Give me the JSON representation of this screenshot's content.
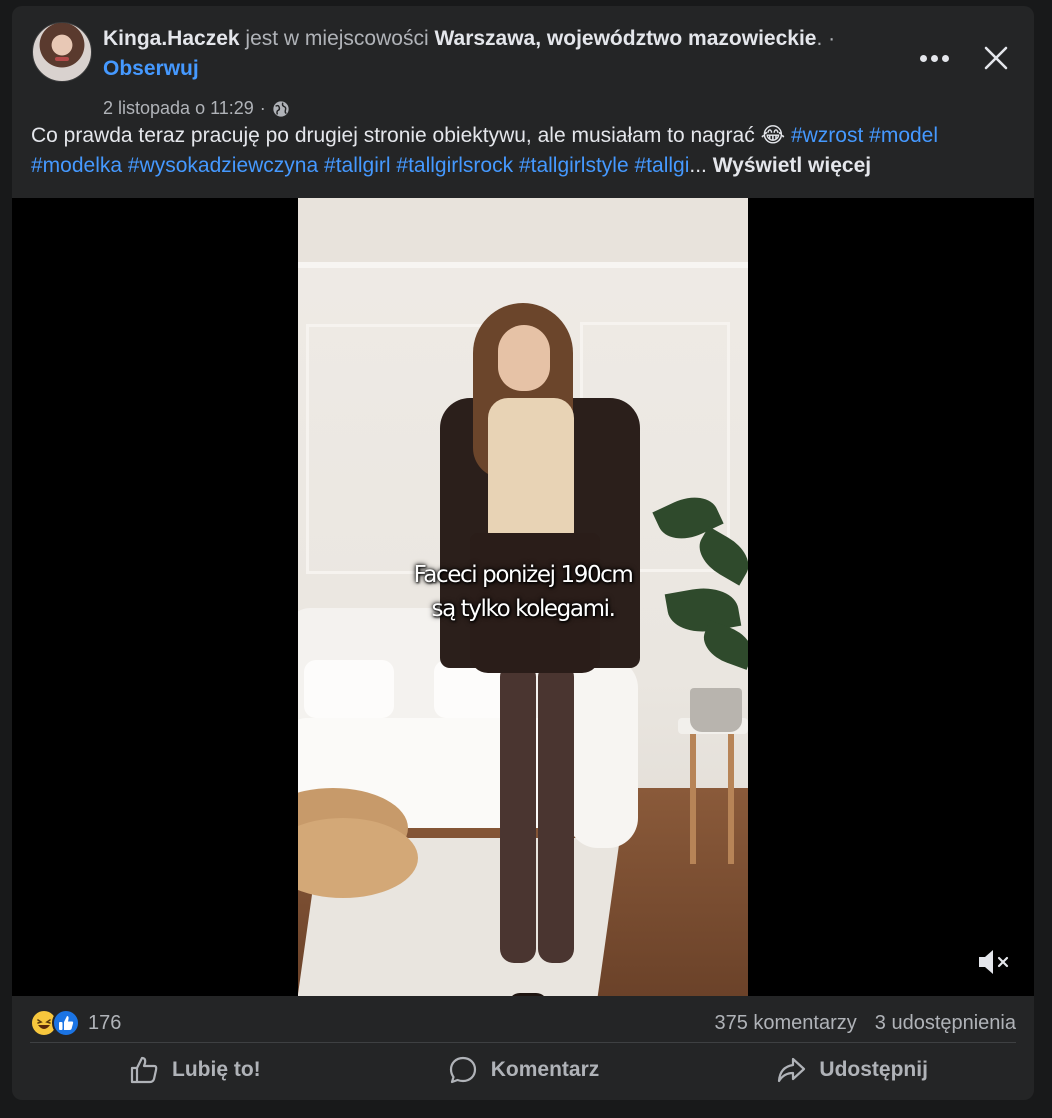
{
  "post": {
    "author": "Kinga.Haczek",
    "location_prefix": "jest w miejscowości",
    "location": "Warszawa, województwo mazowieckie",
    "location_suffix": ". ·",
    "follow_label": "Obserwuj",
    "date": "2 listopada o 11:29",
    "date_separator": "·",
    "audience_icon": "globe-icon",
    "caption_text": "Co prawda teraz pracuję po drugiej stronie obiektywu, ale musiałam to nagrać",
    "caption_emoji": "😂",
    "hashtags": [
      "#wzrost",
      "#model",
      "#modelka",
      "#wysokadziewczyna",
      "#tallgirl",
      "#tallgirlsrock",
      "#tallgirlstyle",
      "#tallgi"
    ],
    "ellipsis": "...",
    "see_more_label": "Wyświetl więcej"
  },
  "video": {
    "subtitle_line1": "Faceci poniżej 190cm",
    "subtitle_line2": "są tylko kolegami.",
    "mute_icon": "speaker-muted-icon"
  },
  "stats": {
    "reaction_icons": [
      "haha-icon",
      "like-icon"
    ],
    "reaction_count": "176",
    "comments": "375 komentarzy",
    "shares": "3 udostępnienia"
  },
  "actions": {
    "like_label": "Lubię to!",
    "comment_label": "Komentarz",
    "share_label": "Udostępnij"
  },
  "colors": {
    "background": "#18191a",
    "card": "#242526",
    "link": "#4599ff",
    "text": "#e4e6eb",
    "muted": "#b0b3b8"
  }
}
